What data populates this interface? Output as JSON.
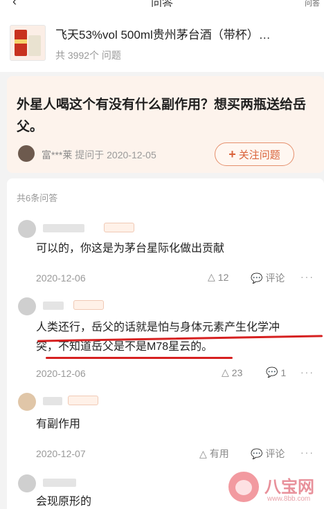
{
  "topbar": {
    "title": "问答",
    "right_label": "问答"
  },
  "product": {
    "name": "飞天53%vol 500ml贵州茅台酒（带杯）…",
    "question_count": "共 3992个 问题"
  },
  "question": {
    "text": "外星人喝这个有没有什么副作用？想买两瓶送给岳父。",
    "asker": "富***莱",
    "asked_label": "提问于 2020-12-05",
    "follow_label": "关注问题"
  },
  "answers_header": "共6条问答",
  "answers": [
    {
      "text": "可以的，你这是为茅台星际化做出贡献",
      "date": "2020-12-06",
      "likes": "12",
      "comment": "评论"
    },
    {
      "text_line1": "人类还行，岳父的话就是怕与身体元素产生化学冲",
      "text_line2": "突，不知道岳父是不是M78星云的。",
      "date": "2020-12-06",
      "likes": "23",
      "comment": "1"
    },
    {
      "text": "有副作用",
      "date": "2020-12-07",
      "likes": "有用",
      "comment": "评论"
    },
    {
      "text": "会现原形的"
    }
  ],
  "watermark": {
    "name": "八宝网",
    "url": "www.8bb.com"
  },
  "colors": {
    "accent": "#d9623a",
    "underline": "#d62020",
    "question_bg": "#fdf3ec"
  },
  "icons": {
    "like": "like-triangle-icon",
    "comment": "comment-bubble-icon",
    "more": "more-dots-icon"
  }
}
